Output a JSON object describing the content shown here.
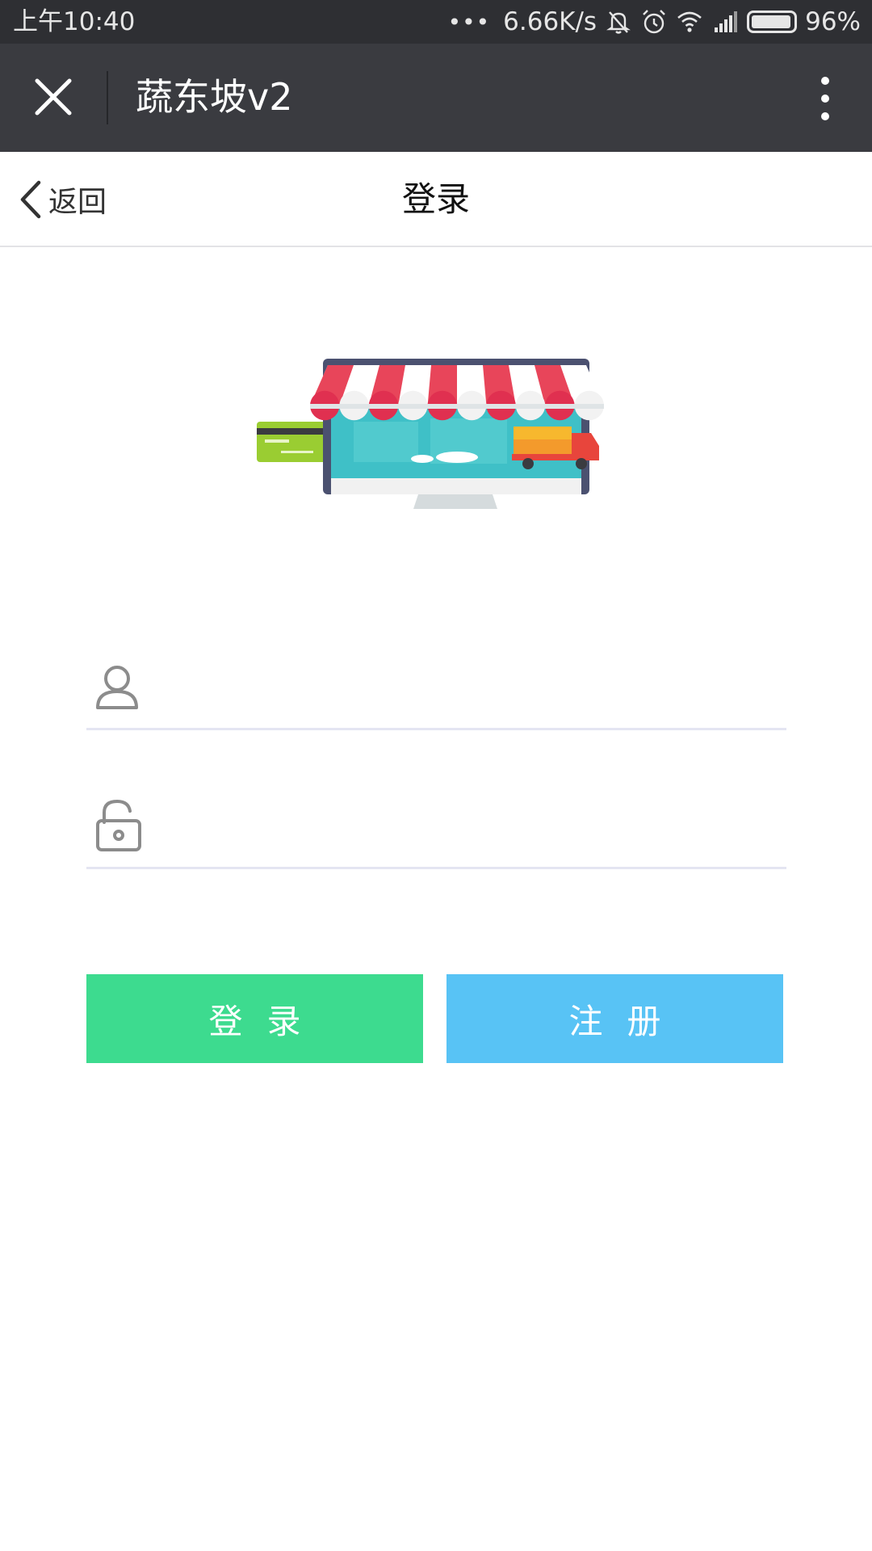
{
  "status_bar": {
    "time": "上午10:40",
    "network_speed": "6.66K/s",
    "battery": "96%",
    "battery_level": 0.96
  },
  "wechat_header": {
    "title": "蔬东坡v2"
  },
  "nav": {
    "back_label": "返回",
    "title": "登录"
  },
  "form": {
    "username_placeholder": "",
    "password_placeholder": ""
  },
  "buttons": {
    "login": "登录",
    "register": "注册"
  },
  "colors": {
    "login": "#3ddb8f",
    "register": "#58c3f5",
    "header": "#3a3b40"
  }
}
